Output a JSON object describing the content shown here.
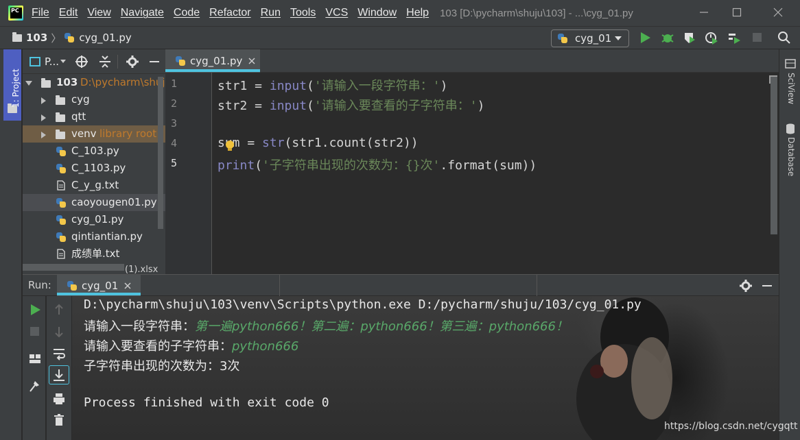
{
  "titlebar": {
    "menu": [
      "File",
      "Edit",
      "View",
      "Navigate",
      "Code",
      "Refactor",
      "Run",
      "Tools",
      "VCS",
      "Window",
      "Help"
    ],
    "window_title": "103 [D:\\pycharm\\shuju\\103] - ...\\cyg_01.py"
  },
  "navbar": {
    "project": "103",
    "file": "cyg_01.py",
    "run_config": "cyg_01"
  },
  "left_strip": {
    "project_tab": "1: Project"
  },
  "project_panel": {
    "header": "P...",
    "root": {
      "name": "103",
      "path": "D:\\pycharm\\shuju"
    },
    "items": [
      {
        "name": "cyg",
        "type": "folder"
      },
      {
        "name": "qtt",
        "type": "folder"
      },
      {
        "name": "venv",
        "type": "folder",
        "note": "library root"
      },
      {
        "name": "C_103.py",
        "type": "py"
      },
      {
        "name": "C_1103.py",
        "type": "py"
      },
      {
        "name": "C_y_g.txt",
        "type": "txt"
      },
      {
        "name": "caoyougen01.py",
        "type": "py"
      },
      {
        "name": "cyg_01.py",
        "type": "py"
      },
      {
        "name": "qintiantian.py",
        "type": "py"
      },
      {
        "name": "成绩单.txt",
        "type": "txt"
      }
    ],
    "partial": "(1).xlsx"
  },
  "editor": {
    "tab": "cyg_01.py",
    "line_numbers": [
      "1",
      "2",
      "3",
      "4",
      "5"
    ],
    "lines": [
      {
        "pre": "str1 = ",
        "builtin": "input",
        "mid": "(",
        "str": "'请输入一段字符串：'",
        "post": ")"
      },
      {
        "pre": "str2 = ",
        "builtin": "input",
        "mid": "(",
        "str": "'请输入要查看的子字符串：'",
        "post": ")"
      },
      {
        "pre": "",
        "builtin": "",
        "mid": "",
        "str": "",
        "post": ""
      },
      {
        "pre": "sum = ",
        "builtin": "str",
        "mid": "(str1.count(str2))",
        "str": "",
        "post": ""
      },
      {
        "pre": "",
        "builtin": "print",
        "mid": "(",
        "str": "'子字符串出现的次数为：{}次'",
        "post": ".format(sum))"
      }
    ]
  },
  "right_strip": {
    "sciview": "SciView",
    "database": "Database"
  },
  "run_panel": {
    "label": "Run:",
    "tab": "cyg_01",
    "console": [
      {
        "prompt": "D:\\pycharm\\shuju\\103\\venv\\Scripts\\python.exe D:/pycharm/shuju/103/cyg_01.py",
        "input": ""
      },
      {
        "prompt": "请输入一段字符串：",
        "input": "第一遍python666！第二遍：python666！第三遍：python666！"
      },
      {
        "prompt": "请输入要查看的子字符串：",
        "input": "python666"
      },
      {
        "prompt": "子字符串出现的次数为：3次",
        "input": ""
      },
      {
        "prompt": "",
        "input": ""
      },
      {
        "prompt": "Process finished with exit code 0",
        "input": ""
      }
    ]
  },
  "watermark": "https://blog.csdn.net/cygqtt"
}
